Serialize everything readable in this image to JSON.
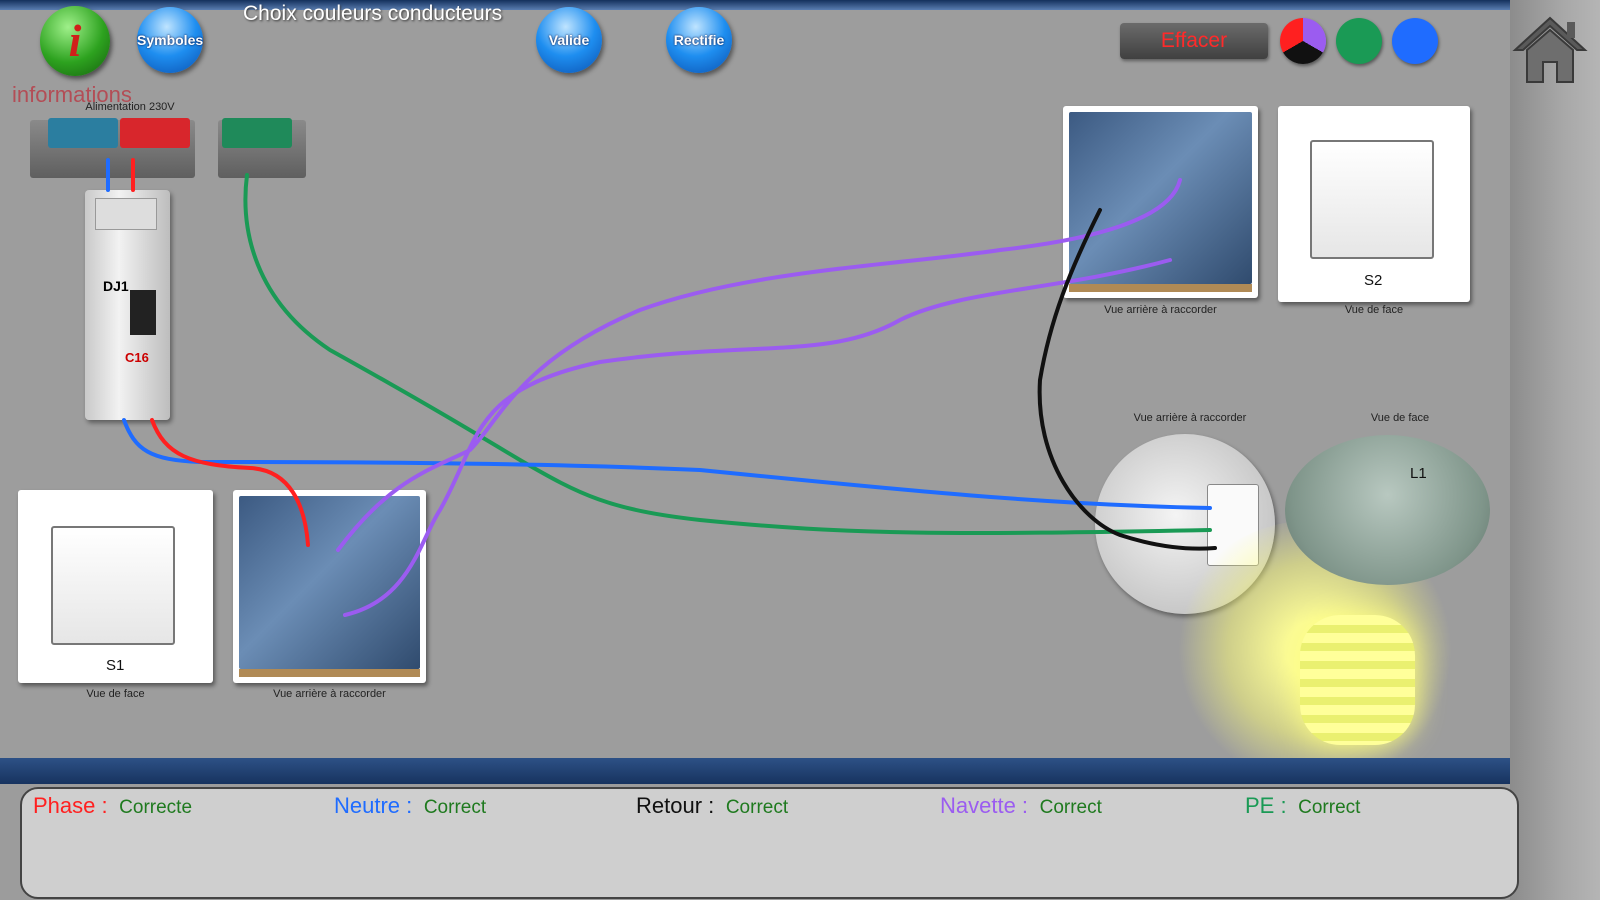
{
  "header": {
    "title": "Choix couleurs conducteurs",
    "info_symbol": "i",
    "info_label": "informations",
    "symboles_label": "Symboles",
    "valide_label": "Valide",
    "rectifie_label": "Rectifie",
    "effacer_label": "Effacer"
  },
  "colors": {
    "phase": "#ff2020",
    "neutre": "#1f6cff",
    "retour": "#111111",
    "navette": "#9b5cf0",
    "pe": "#1a9a55",
    "ok": "#1f7a1f"
  },
  "diagram": {
    "alimentation_label": "Alimentation 230V",
    "breaker_label": "DJ1",
    "breaker_rating": "C16",
    "s1_label": "S1",
    "s2_label": "S2",
    "lamp_label": "L1",
    "vue_face": "Vue de face",
    "vue_arriere": "Vue arrière à raccorder"
  },
  "status": {
    "phase_label": "Phase :",
    "phase_value": "Correcte",
    "neutre_label": "Neutre :",
    "neutre_value": "Correct",
    "retour_label": "Retour :",
    "retour_value": "Correct",
    "navette_label": "Navette :",
    "navette_value": "Correct",
    "pe_label": "PE :",
    "pe_value": "Correct"
  }
}
